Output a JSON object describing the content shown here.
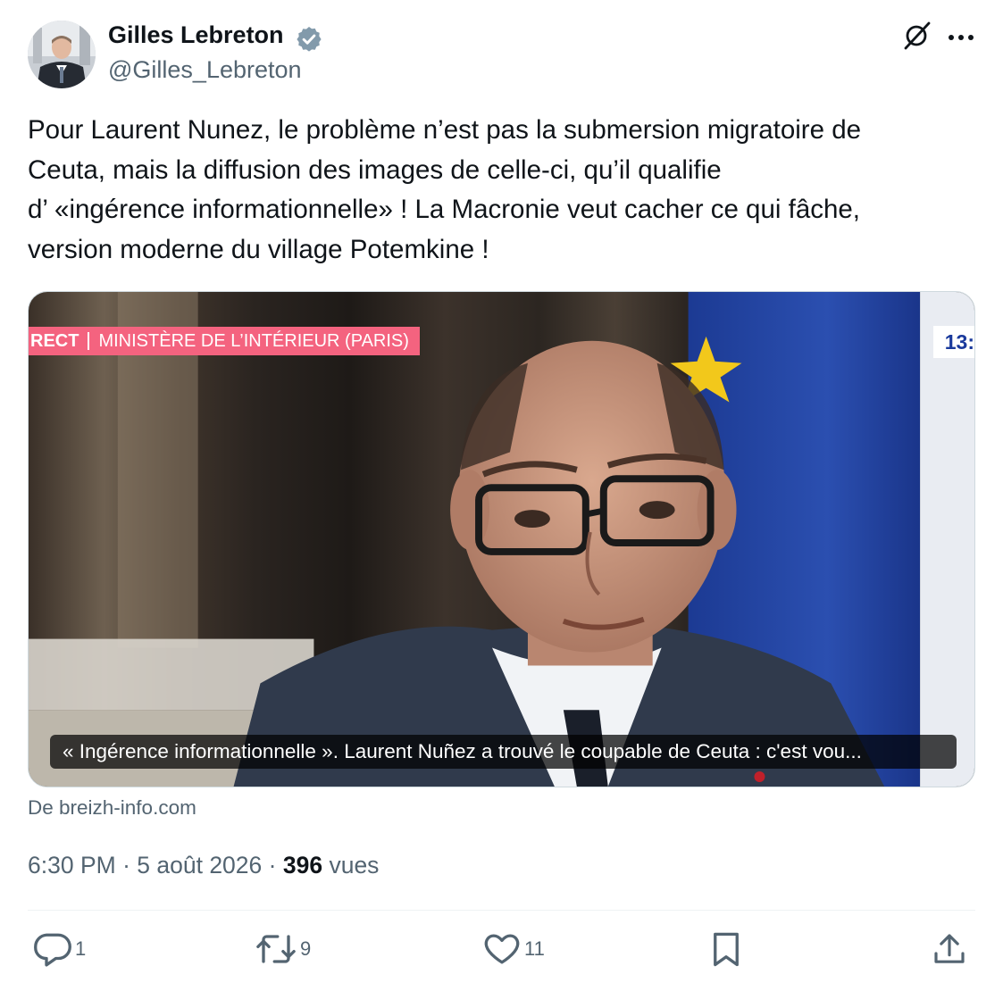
{
  "author": {
    "name": "Gilles Lebreton",
    "handle": "@Gilles_Lebreton",
    "verified": true
  },
  "tweet": {
    "text_lines": [
      "Pour Laurent Nunez, le problème n’est pas la submersion migratoire de",
      "Ceuta, mais la diffusion des images de celle-ci, qu’il qualifie",
      "d’ «ingérence informationnelle» ! La Macronie veut cacher ce qui fâche,",
      "version moderne du village Potemkine !"
    ]
  },
  "card": {
    "banner_live": "RECT",
    "banner_location": "MINISTÈRE DE L’INTÉRIEUR (PARIS)",
    "clock_text": "13:",
    "caption": "« Ingérence informationnelle ». Laurent Nuñez a trouvé le coupable de Ceuta : c'est vou...",
    "source": "De breizh-info.com"
  },
  "meta": {
    "time": "6:30 PM",
    "separator": "·",
    "date": "5 août 2026",
    "views_count": "396",
    "views_label": "vues"
  },
  "actions": {
    "reply_count": "1",
    "retweet_count": "9",
    "like_count": "11"
  },
  "icons": {
    "verified": "verified-badge-icon",
    "grok": "grok-icon",
    "more": "more-icon",
    "reply": "reply-icon",
    "retweet": "retweet-icon",
    "like": "heart-icon",
    "bookmark": "bookmark-icon",
    "share": "share-icon"
  },
  "colors": {
    "text": "#0f1419",
    "secondary": "#536471",
    "verified_blue": "#829aab",
    "banner_pink": "#f4637f"
  }
}
